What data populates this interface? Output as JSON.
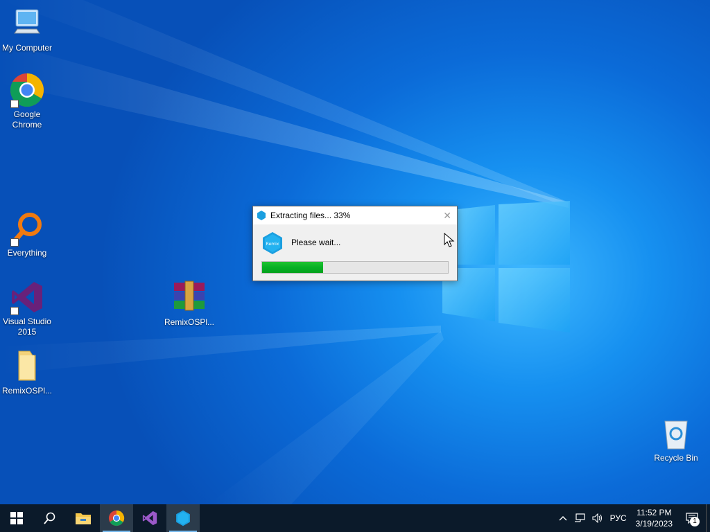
{
  "desktop": {
    "icons": [
      {
        "label": "My Computer"
      },
      {
        "label": "Google Chrome"
      },
      {
        "label": "Everything"
      },
      {
        "label": "Visual Studio 2015"
      },
      {
        "label": "RemixOSPl..."
      },
      {
        "label": "RemixOSPl..."
      },
      {
        "label": "Recycle Bin"
      }
    ]
  },
  "dialog": {
    "title": "Extracting files... 33%",
    "message": "Please wait...",
    "close_glyph": "✕",
    "progress": 0.33,
    "app_icon": "remix-os-icon"
  },
  "taskbar": {
    "buttons": [
      "start-icon",
      "search-icon",
      "file-explorer-icon",
      "chrome-icon",
      "visual-studio-icon",
      "remix-os-icon"
    ],
    "tray": {
      "chevron": "^",
      "language": "РУС",
      "time": "11:52 PM",
      "date": "3/19/2023",
      "notification_count": "1"
    }
  },
  "colors": {
    "accent": "#0b6bd8",
    "progress": "#06b025",
    "taskbar": "#0b1a2a"
  }
}
